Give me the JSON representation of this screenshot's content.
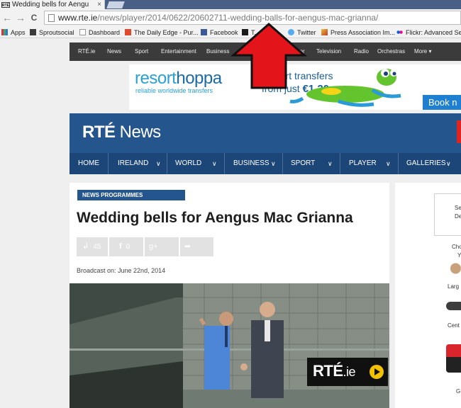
{
  "browser": {
    "tab": {
      "title": "Wedding bells for Aengu",
      "close": "×",
      "favicon": "RTÉ"
    },
    "nav": {
      "back": "←",
      "forward": "→",
      "reload": "C"
    },
    "url": {
      "host": "www.rte.ie",
      "path": "/news/player/2014/0622/20602711-wedding-balls-for-aengus-mac-grianna/"
    },
    "bookmarks": [
      {
        "label": "Apps",
        "icon": "apps-grid-icon"
      },
      {
        "label": "Sproutsocial",
        "icon": "sproutsocial-icon"
      },
      {
        "label": "Dashboard",
        "icon": "page-icon"
      },
      {
        "label": "The Daily Edge - Pur...",
        "icon": "dailyedge-icon"
      },
      {
        "label": "Facebook",
        "icon": "facebook-icon"
      },
      {
        "label": "T...Deck",
        "icon": "twitter-icon"
      },
      {
        "label": "Twitter",
        "icon": "twitter-icon"
      },
      {
        "label": "Press Association Im...",
        "icon": "pa-icon"
      },
      {
        "label": "Flickr: Advanced Sea",
        "icon": "flickr-icon"
      }
    ]
  },
  "site": {
    "topbar": [
      "RTÉ.ie",
      "News",
      "Sport",
      "Entertainment",
      "Business",
      "Player",
      "Television",
      "Radio",
      "Orchestras",
      "More"
    ],
    "topbar_more_caret": "▾",
    "ad": {
      "brand_a": "resort",
      "brand_b": "hoppa",
      "tagline": "reliable worldwide transfers",
      "offer_line1": "port transfers",
      "offer_line2_prefix": "from just ",
      "price": "€1.20",
      "cta": "Book n"
    },
    "brand": {
      "a": "RTÉ",
      "b": " News"
    },
    "nav": [
      "HOME",
      "IRELAND",
      "WORLD",
      "BUSINESS",
      "SPORT",
      "PLAYER",
      "GALLERIES"
    ],
    "nav_caret": "∨"
  },
  "article": {
    "kicker": "NEWS PROGRAMMES",
    "headline": "Wedding bells for Aengus Mac Grianna",
    "share": {
      "twitter_icon": "↲",
      "twitter_count": "45",
      "facebook_icon": "f",
      "facebook_count": "0",
      "gplus": "g+",
      "forward": "➦"
    },
    "broadcast": "Broadcast on: June 22nd, 2014",
    "video_badge": {
      "a": "RTÉ",
      "b": ".ie"
    }
  },
  "sidebar": {
    "lines": [
      "Se",
      "De",
      "Cho",
      "Y",
      "Larg",
      "Cent",
      "G"
    ]
  },
  "colors": {
    "arrow": "#e3151b",
    "rte_blue": "#25558d",
    "nav_blue": "#1d4678",
    "ad_blue": "#29a0d6",
    "play_yellow": "#f2c200"
  }
}
